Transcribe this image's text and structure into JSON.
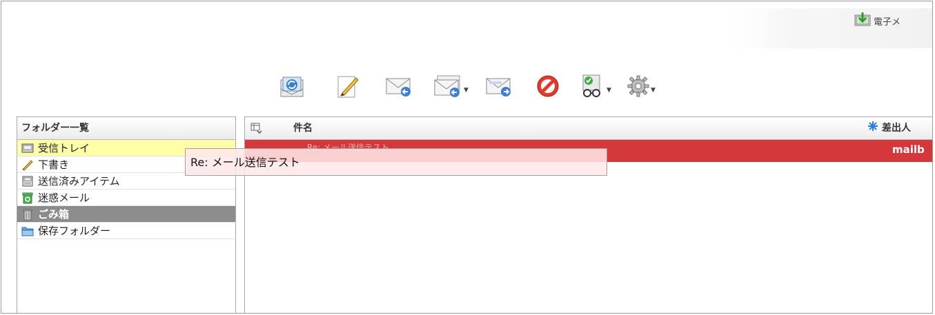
{
  "header": {
    "notice_label": "電子メ",
    "notice_icon": "download-box-icon"
  },
  "toolbar": {
    "buttons": [
      {
        "name": "receive-send",
        "icon": "refresh-mail-icon"
      },
      {
        "name": "compose",
        "icon": "pencil-paper-icon"
      },
      {
        "name": "reply",
        "icon": "reply-mail-icon"
      },
      {
        "name": "reply-all",
        "icon": "reply-all-mail-icon",
        "has_dropdown": true
      },
      {
        "name": "forward",
        "icon": "forward-mail-icon"
      },
      {
        "name": "block",
        "icon": "prohibit-icon"
      },
      {
        "name": "view",
        "icon": "viewer-glasses-icon",
        "has_dropdown": true
      },
      {
        "name": "settings",
        "icon": "gear-icon",
        "has_dropdown": true
      }
    ]
  },
  "folders": {
    "header": "フォルダー一覧",
    "items": [
      {
        "label": "受信トレイ",
        "icon": "inbox-icon",
        "state": "active"
      },
      {
        "label": "下書き",
        "icon": "pencil-icon",
        "state": "normal"
      },
      {
        "label": "送信済みアイテム",
        "icon": "sent-items-icon",
        "state": "normal"
      },
      {
        "label": "迷惑メール",
        "icon": "junk-recycle-icon",
        "state": "normal"
      },
      {
        "label": "ごみ箱",
        "icon": "trash-icon",
        "state": "selected"
      },
      {
        "label": "保存フォルダー",
        "icon": "folder-icon",
        "state": "normal"
      }
    ]
  },
  "message_list": {
    "columns": {
      "subject": "件名",
      "sender": "差出人"
    },
    "rows": [
      {
        "subject": "Re: メール送信テスト",
        "sender": "mailb",
        "highlight_color": "#d4383b"
      }
    ]
  },
  "tooltip": {
    "text": "Re: メール送信テスト"
  },
  "colors": {
    "selected_folder": "#8c8c8c",
    "active_folder": "#ffffa8",
    "highlight_row": "#d4383b"
  }
}
